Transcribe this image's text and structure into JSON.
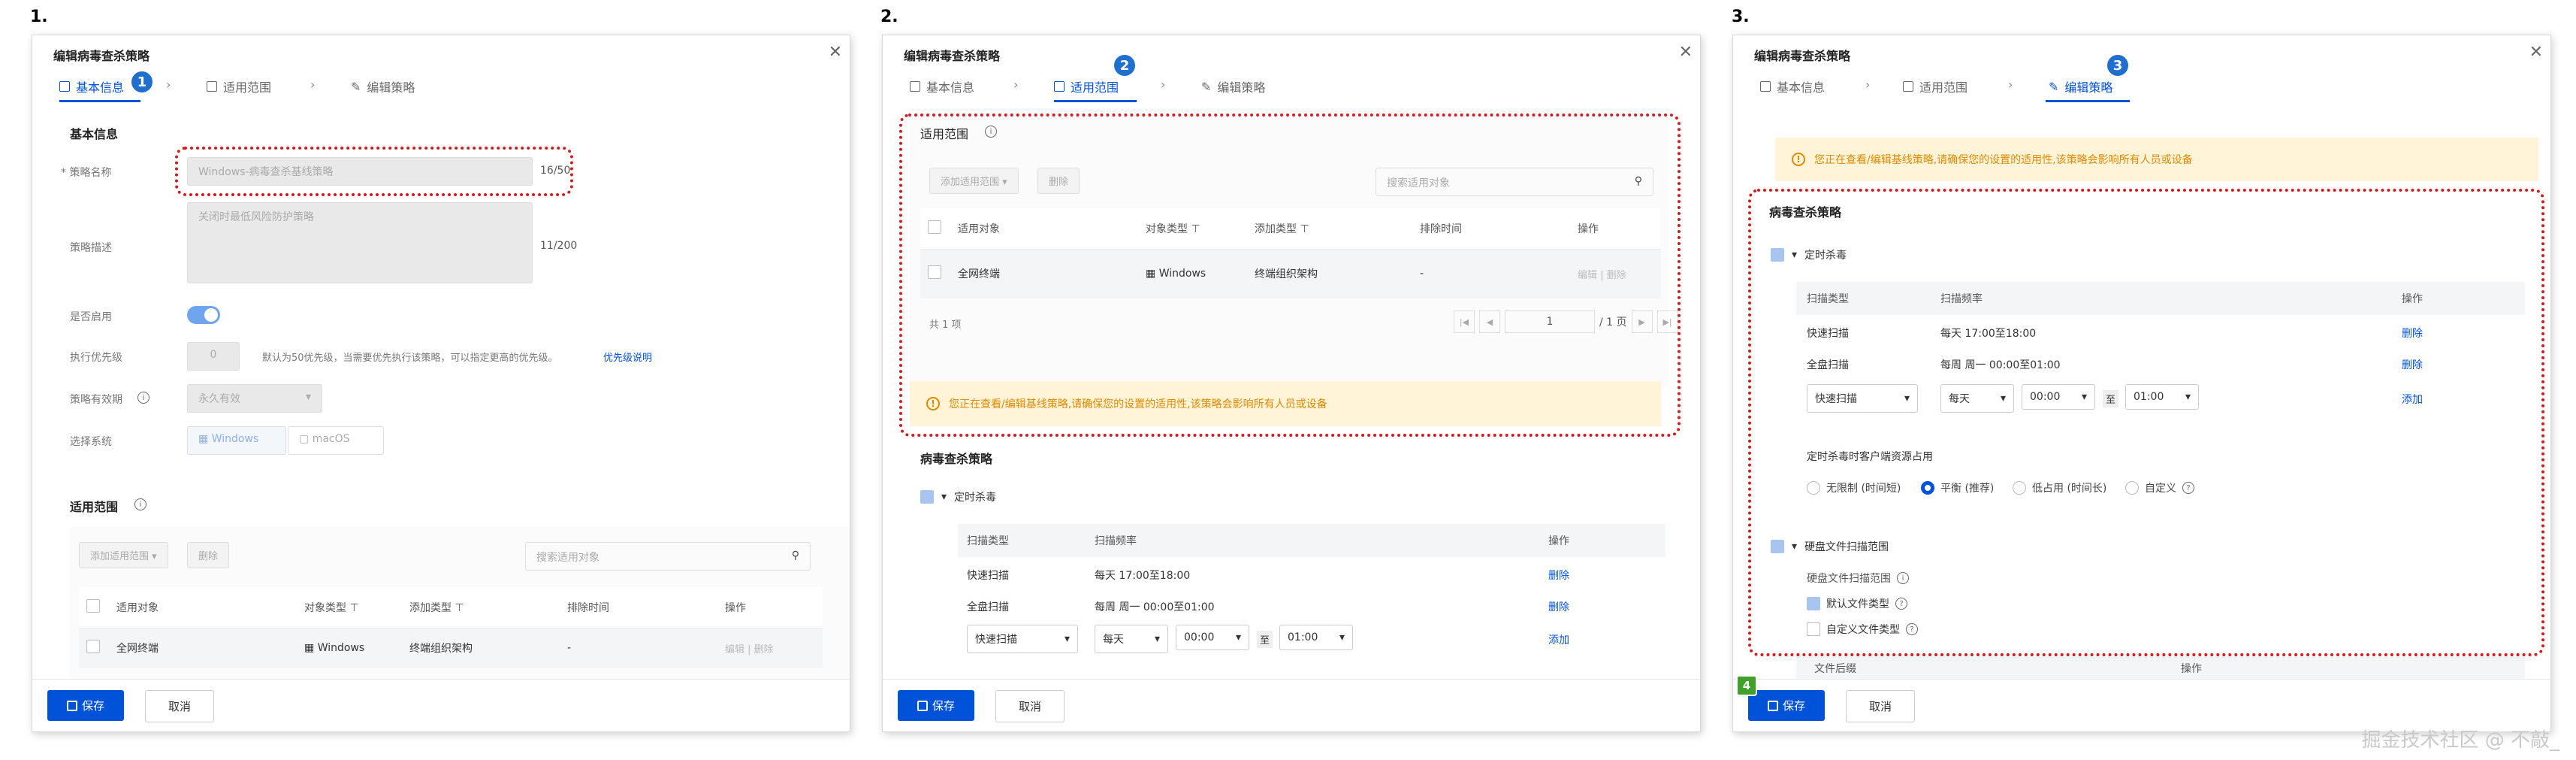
{
  "steps": [
    "1.",
    "2.",
    "3."
  ],
  "badges": [
    "1",
    "2",
    "3",
    "4"
  ],
  "dialog_title": "编辑病毒查杀策略",
  "tabs": [
    "基本信息",
    "适用范围",
    "编辑策略"
  ],
  "basic": {
    "section": "基本信息",
    "name_label": "* 策略名称",
    "name_value": "Windows-病毒查杀基线策略",
    "name_count": "16/50",
    "desc_label": "策略描述",
    "desc_value": "关闭时最低风险防护策略",
    "desc_count": "11/200",
    "enable_label": "是否启用",
    "priority_label": "执行优先级",
    "priority_value": "0",
    "priority_hint": "默认为50优先级，当需要优先执行该策略，可以指定更高的优先级。",
    "priority_link": "优先级说明",
    "validity_label": "策略有效期",
    "validity_value": "永久有效",
    "os_label": "选择系统",
    "os_options": [
      "Windows",
      "macOS"
    ]
  },
  "scope": {
    "section": "适用范围",
    "add_btn": "添加适用范围",
    "delete_btn": "删除",
    "search_placeholder": "搜索适用对象",
    "columns": [
      "适用对象",
      "对象类型",
      "添加类型",
      "排除时间",
      "操作"
    ],
    "row": [
      "全网终端",
      "Windows",
      "终端组织架构",
      "-"
    ],
    "row_ops": [
      "编辑",
      "删除"
    ],
    "total": "共 1 项",
    "page": "1",
    "pages": "/ 1 页"
  },
  "warning": "您正在查看/编辑基线策略,请确保您的设置的适用性,该策略会影响所有人员或设备",
  "policy": {
    "section": "病毒查杀策略",
    "scheduled": "定时杀毒",
    "columns": [
      "扫描类型",
      "扫描频率",
      "操作"
    ],
    "rows": [
      [
        "快速扫描",
        "每天 17:00至18:00",
        "删除"
      ],
      [
        "全盘扫描",
        "每周 周一 00:00至01:00",
        "删除"
      ]
    ],
    "new_row": {
      "type": "快速扫描",
      "freq": "每天",
      "start": "00:00",
      "to": "至",
      "end": "01:00",
      "add": "添加"
    },
    "resource_label": "定时杀毒时客户端资源占用",
    "resource_options": [
      "无限制 (时间短)",
      "平衡 (推荐)",
      "低占用 (时间长)",
      "自定义"
    ],
    "disk_scan": "硬盘文件扫描范围",
    "disk_scan_label": "硬盘文件扫描范围",
    "default_types": "默认文件类型",
    "custom_types": "自定义文件类型",
    "ext_col": "文件后缀",
    "op_col": "操作"
  },
  "footer": {
    "save": "保存",
    "cancel": "取消"
  },
  "watermark": "掘金技术社区 @ 不敲_"
}
